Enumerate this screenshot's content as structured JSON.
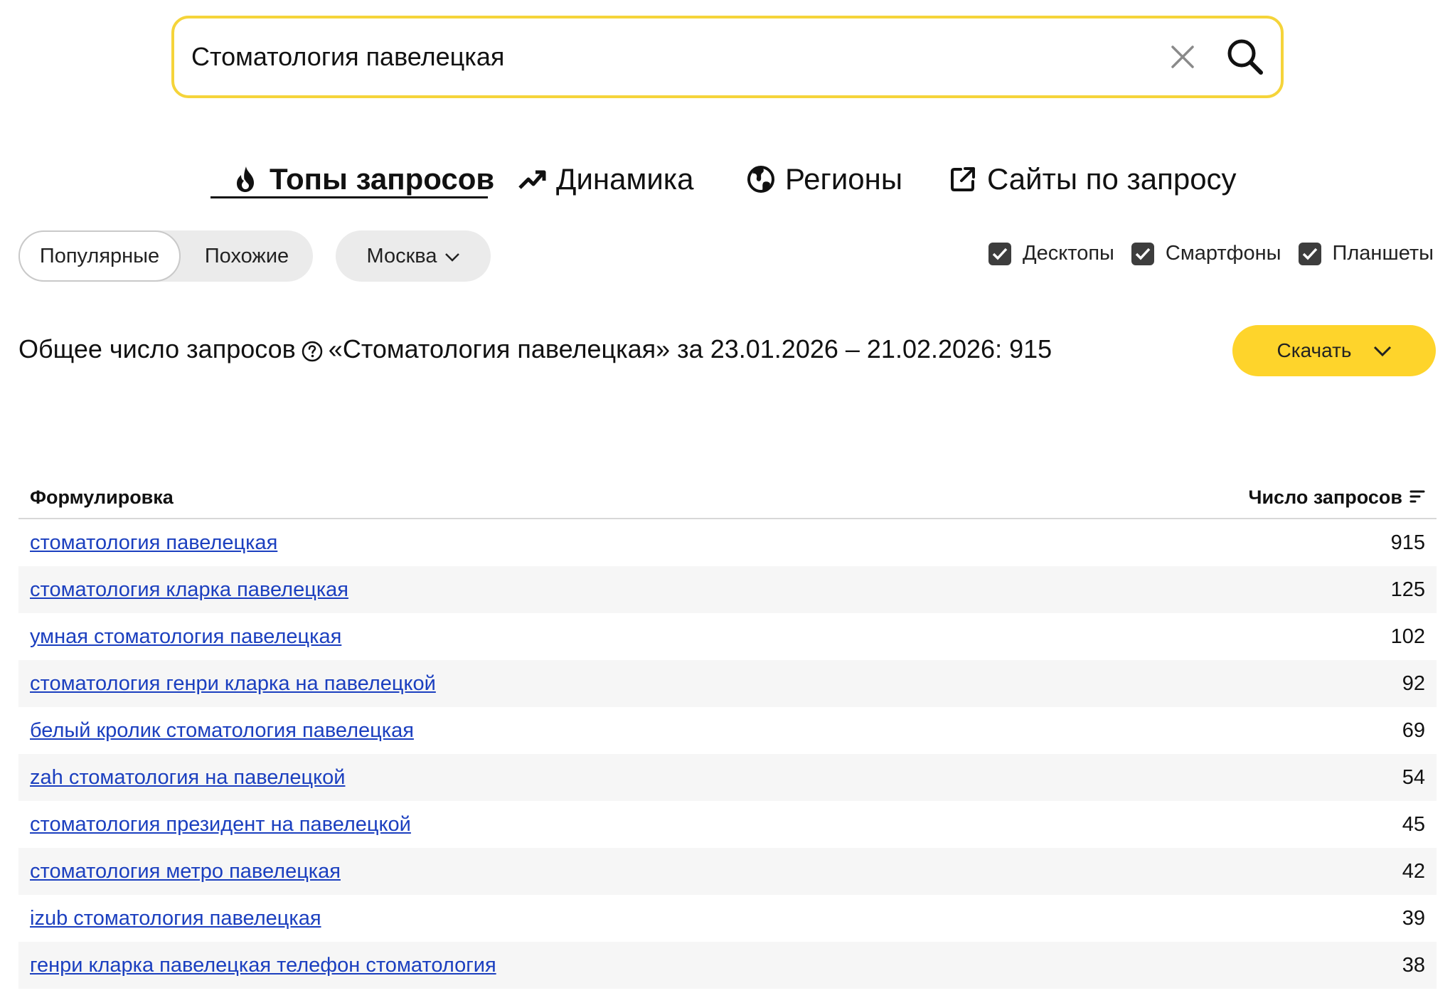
{
  "search": {
    "value": "Стоматология павелецкая"
  },
  "tabs": [
    {
      "label": "Топы запросов",
      "icon": "flame-icon",
      "active": true
    },
    {
      "label": "Динамика",
      "icon": "trend-up-icon",
      "active": false
    },
    {
      "label": "Регионы",
      "icon": "globe-icon",
      "active": false
    },
    {
      "label": "Сайты по запросу",
      "icon": "external-link-icon",
      "active": false
    }
  ],
  "filters": {
    "mode": {
      "popular": "Популярные",
      "similar": "Похожие",
      "selected": "Популярные"
    },
    "region": "Москва",
    "devices": [
      {
        "label": "Десктопы",
        "checked": true
      },
      {
        "label": "Смартфоны",
        "checked": true
      },
      {
        "label": "Планшеты",
        "checked": true
      }
    ]
  },
  "summary": {
    "prefix": "Общее число запросов",
    "text": "«Стоматология павелецкая» за 23.01.2026 – 21.02.2026: 915"
  },
  "download": {
    "label": "Скачать"
  },
  "table": {
    "col_query": "Формулировка",
    "col_count": "Число запросов",
    "rows": [
      {
        "query": "стоматология павелецкая",
        "count": "915"
      },
      {
        "query": "стоматология кларка павелецкая",
        "count": "125"
      },
      {
        "query": "умная стоматология павелецкая",
        "count": "102"
      },
      {
        "query": "стоматология генри кларка на павелецкой",
        "count": "92"
      },
      {
        "query": "белый кролик стоматология павелецкая",
        "count": "69"
      },
      {
        "query": "zah стоматология на павелецкой",
        "count": "54"
      },
      {
        "query": "стоматология президент на павелецкой",
        "count": "45"
      },
      {
        "query": "стоматология метро павелецкая",
        "count": "42"
      },
      {
        "query": "izub стоматология павелецкая",
        "count": "39"
      },
      {
        "query": "генри кларка павелецкая телефон стоматология",
        "count": "38"
      }
    ]
  },
  "colors": {
    "accent": "#fed42b",
    "search_border": "#f5d43a",
    "link": "#1b3fbf"
  }
}
